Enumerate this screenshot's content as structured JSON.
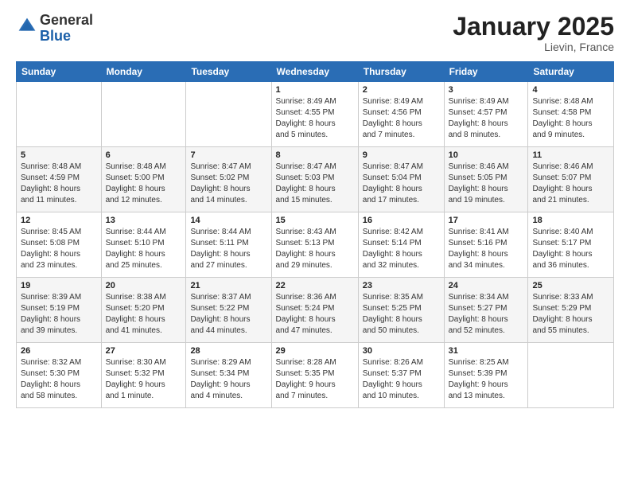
{
  "header": {
    "logo_general": "General",
    "logo_blue": "Blue",
    "month": "January 2025",
    "location": "Lievin, France"
  },
  "weekdays": [
    "Sunday",
    "Monday",
    "Tuesday",
    "Wednesday",
    "Thursday",
    "Friday",
    "Saturday"
  ],
  "weeks": [
    [
      {
        "day": "",
        "info": ""
      },
      {
        "day": "",
        "info": ""
      },
      {
        "day": "",
        "info": ""
      },
      {
        "day": "1",
        "info": "Sunrise: 8:49 AM\nSunset: 4:55 PM\nDaylight: 8 hours\nand 5 minutes."
      },
      {
        "day": "2",
        "info": "Sunrise: 8:49 AM\nSunset: 4:56 PM\nDaylight: 8 hours\nand 7 minutes."
      },
      {
        "day": "3",
        "info": "Sunrise: 8:49 AM\nSunset: 4:57 PM\nDaylight: 8 hours\nand 8 minutes."
      },
      {
        "day": "4",
        "info": "Sunrise: 8:48 AM\nSunset: 4:58 PM\nDaylight: 8 hours\nand 9 minutes."
      }
    ],
    [
      {
        "day": "5",
        "info": "Sunrise: 8:48 AM\nSunset: 4:59 PM\nDaylight: 8 hours\nand 11 minutes."
      },
      {
        "day": "6",
        "info": "Sunrise: 8:48 AM\nSunset: 5:00 PM\nDaylight: 8 hours\nand 12 minutes."
      },
      {
        "day": "7",
        "info": "Sunrise: 8:47 AM\nSunset: 5:02 PM\nDaylight: 8 hours\nand 14 minutes."
      },
      {
        "day": "8",
        "info": "Sunrise: 8:47 AM\nSunset: 5:03 PM\nDaylight: 8 hours\nand 15 minutes."
      },
      {
        "day": "9",
        "info": "Sunrise: 8:47 AM\nSunset: 5:04 PM\nDaylight: 8 hours\nand 17 minutes."
      },
      {
        "day": "10",
        "info": "Sunrise: 8:46 AM\nSunset: 5:05 PM\nDaylight: 8 hours\nand 19 minutes."
      },
      {
        "day": "11",
        "info": "Sunrise: 8:46 AM\nSunset: 5:07 PM\nDaylight: 8 hours\nand 21 minutes."
      }
    ],
    [
      {
        "day": "12",
        "info": "Sunrise: 8:45 AM\nSunset: 5:08 PM\nDaylight: 8 hours\nand 23 minutes."
      },
      {
        "day": "13",
        "info": "Sunrise: 8:44 AM\nSunset: 5:10 PM\nDaylight: 8 hours\nand 25 minutes."
      },
      {
        "day": "14",
        "info": "Sunrise: 8:44 AM\nSunset: 5:11 PM\nDaylight: 8 hours\nand 27 minutes."
      },
      {
        "day": "15",
        "info": "Sunrise: 8:43 AM\nSunset: 5:13 PM\nDaylight: 8 hours\nand 29 minutes."
      },
      {
        "day": "16",
        "info": "Sunrise: 8:42 AM\nSunset: 5:14 PM\nDaylight: 8 hours\nand 32 minutes."
      },
      {
        "day": "17",
        "info": "Sunrise: 8:41 AM\nSunset: 5:16 PM\nDaylight: 8 hours\nand 34 minutes."
      },
      {
        "day": "18",
        "info": "Sunrise: 8:40 AM\nSunset: 5:17 PM\nDaylight: 8 hours\nand 36 minutes."
      }
    ],
    [
      {
        "day": "19",
        "info": "Sunrise: 8:39 AM\nSunset: 5:19 PM\nDaylight: 8 hours\nand 39 minutes."
      },
      {
        "day": "20",
        "info": "Sunrise: 8:38 AM\nSunset: 5:20 PM\nDaylight: 8 hours\nand 41 minutes."
      },
      {
        "day": "21",
        "info": "Sunrise: 8:37 AM\nSunset: 5:22 PM\nDaylight: 8 hours\nand 44 minutes."
      },
      {
        "day": "22",
        "info": "Sunrise: 8:36 AM\nSunset: 5:24 PM\nDaylight: 8 hours\nand 47 minutes."
      },
      {
        "day": "23",
        "info": "Sunrise: 8:35 AM\nSunset: 5:25 PM\nDaylight: 8 hours\nand 50 minutes."
      },
      {
        "day": "24",
        "info": "Sunrise: 8:34 AM\nSunset: 5:27 PM\nDaylight: 8 hours\nand 52 minutes."
      },
      {
        "day": "25",
        "info": "Sunrise: 8:33 AM\nSunset: 5:29 PM\nDaylight: 8 hours\nand 55 minutes."
      }
    ],
    [
      {
        "day": "26",
        "info": "Sunrise: 8:32 AM\nSunset: 5:30 PM\nDaylight: 8 hours\nand 58 minutes."
      },
      {
        "day": "27",
        "info": "Sunrise: 8:30 AM\nSunset: 5:32 PM\nDaylight: 9 hours\nand 1 minute."
      },
      {
        "day": "28",
        "info": "Sunrise: 8:29 AM\nSunset: 5:34 PM\nDaylight: 9 hours\nand 4 minutes."
      },
      {
        "day": "29",
        "info": "Sunrise: 8:28 AM\nSunset: 5:35 PM\nDaylight: 9 hours\nand 7 minutes."
      },
      {
        "day": "30",
        "info": "Sunrise: 8:26 AM\nSunset: 5:37 PM\nDaylight: 9 hours\nand 10 minutes."
      },
      {
        "day": "31",
        "info": "Sunrise: 8:25 AM\nSunset: 5:39 PM\nDaylight: 9 hours\nand 13 minutes."
      },
      {
        "day": "",
        "info": ""
      }
    ]
  ]
}
